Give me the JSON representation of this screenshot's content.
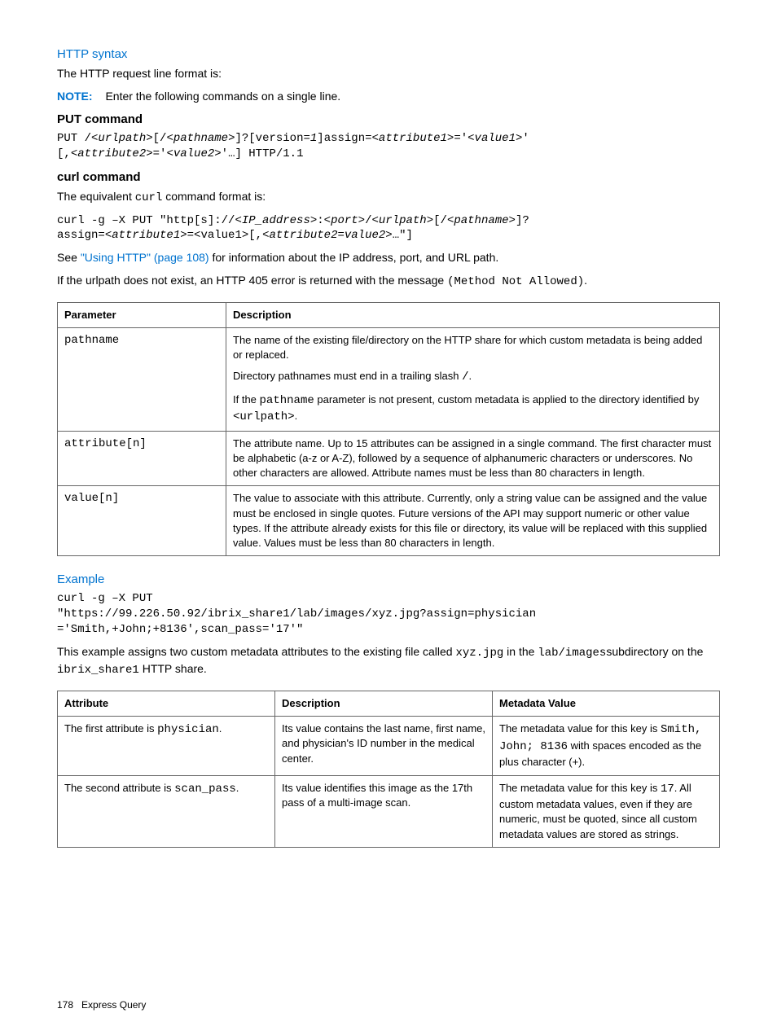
{
  "http_syntax_heading": "HTTP syntax",
  "http_syntax_intro": "The HTTP request line format is:",
  "note_label": "NOTE:",
  "note_text": "Enter the following commands on a single line.",
  "put_heading": "PUT command",
  "put_code_1": "PUT /",
  "put_code_urlpath": "<urlpath>",
  "put_code_2": "[/",
  "put_code_pathname": "<pathname>",
  "put_code_3": "]?[version=",
  "put_code_ver": "1",
  "put_code_4": "]assign=",
  "put_code_attr1": "<attribute1>",
  "put_code_5a": "='",
  "put_code_val1": "<value1>",
  "put_code_5": "'\n[,",
  "put_code_attr2": "<attribute2>",
  "put_code_6": "='",
  "put_code_val2": "<value2>",
  "put_code_7": "'…] HTTP/1.1",
  "curl_heading": "curl command",
  "curl_intro_pre": "The equivalent ",
  "curl_intro_mono": "curl",
  "curl_intro_post": " command format is:",
  "curl_code_1": "curl -g –X PUT \"http[s]://",
  "curl_code_ip": "<IP_address>",
  "curl_code_colon": ":",
  "curl_code_port": "<port>",
  "curl_code_slash": "/",
  "curl_code_urlpath": "<urlpath>",
  "curl_code_bracket1": "[/",
  "curl_code_pathname": "<pathname>",
  "curl_code_bracket2": "]?\nassign=",
  "curl_code_attr1": "<attribute1>",
  "curl_code_eq": "=<value1>[,",
  "curl_code_attr2val": "<attribute2=value2>",
  "curl_code_end": "…\"]",
  "see_pre": "See ",
  "see_link": "\"Using HTTP\" (page 108)",
  "see_post": " for information about the IP address, port, and URL path.",
  "urlpath_err_pre": "If the urlpath does not exist, an HTTP 405 error is returned with the message ",
  "urlpath_err_mono": "(Method Not Allowed)",
  "urlpath_err_post": ".",
  "table1": {
    "h1": "Parameter",
    "h2": "Description",
    "rows": [
      {
        "param": "pathname",
        "desc_p1": "The name of the existing file/directory on the HTTP share for which custom metadata is being added or replaced.",
        "desc_p2_pre": "Directory pathnames must end in a trailing slash ",
        "desc_p2_mono": "/",
        "desc_p2_post": ".",
        "desc_p3_pre": "If the ",
        "desc_p3_mono1": "pathname",
        "desc_p3_mid": " parameter is not present, custom metadata is applied to the directory identified by ",
        "desc_p3_mono2": "<urlpath>",
        "desc_p3_post": "."
      },
      {
        "param": "attribute[n]",
        "desc": "The attribute name. Up to 15 attributes can be assigned in a single command. The first character must be alphabetic (a-z or A-Z), followed by a sequence of alphanumeric characters or underscores. No other characters are allowed. Attribute names must be less than 80 characters in length."
      },
      {
        "param": "value[n]",
        "desc": "The value to associate with this attribute. Currently, only a string value can be assigned and the value must be enclosed in single quotes. Future versions of the API may support numeric or other value types. If the attribute already exists for this file or directory, its value will be replaced with this supplied value. Values must be less than 80 characters in length."
      }
    ]
  },
  "example_heading": "Example",
  "example_code": "curl -g –X PUT\n\"https://99.226.50.92/ibrix_share1/lab/images/xyz.jpg?assign=physician\n='Smith,+John;+8136',scan_pass='17'\"",
  "example_text_pre": "This example assigns two custom metadata attributes to the existing file called ",
  "example_text_mono1": "xyz.jpg",
  "example_text_mid1": " in the ",
  "example_text_mono2": "lab/images",
  "example_text_mid2": "subdirectory on the ",
  "example_text_mono3": "ibrix_share1",
  "example_text_post": " HTTP share.",
  "table2": {
    "h1": "Attribute",
    "h2": "Description",
    "h3": "Metadata Value",
    "rows": [
      {
        "attr_pre": "The first attribute is ",
        "attr_mono": "physician",
        "attr_post": ".",
        "desc": "Its value contains the last name, first name, and physician's ID number in the medical center.",
        "meta_pre": "The metadata value for this key is ",
        "meta_mono": "Smith, John; 8136",
        "meta_post": " with spaces encoded as the plus character (+)."
      },
      {
        "attr_pre": "The second attribute is ",
        "attr_mono": "scan_pass",
        "attr_post": ".",
        "desc": "Its value identifies this image as the 17th pass of a multi-image scan.",
        "meta_pre": "The metadata value for this key is ",
        "meta_mono": "17",
        "meta_post": ". All custom metadata values, even if they are numeric, must be quoted, since all custom metadata values are stored as strings."
      }
    ]
  },
  "footer_page": "178",
  "footer_text": "Express Query"
}
